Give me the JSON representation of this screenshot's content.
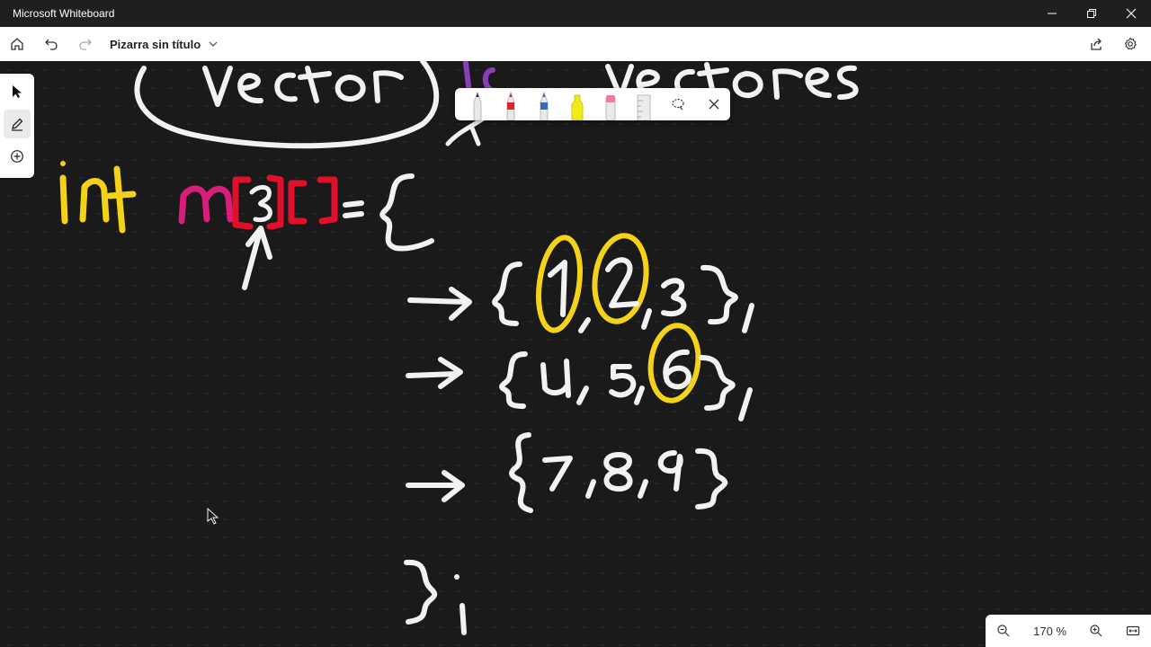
{
  "window": {
    "title": "Microsoft Whiteboard"
  },
  "toolbar": {
    "doc_title": "Pizarra sin título"
  },
  "zoom": {
    "level": "170 %"
  },
  "icons": {
    "home": "home-icon",
    "undo": "undo-icon",
    "redo": "redo-icon",
    "chevron": "chevron-down-icon",
    "share": "share-icon",
    "settings": "gear-icon",
    "select": "pointer-icon",
    "pen": "pen-icon",
    "add": "plus-circle-icon",
    "lasso": "lasso-icon",
    "close": "close-icon",
    "zoom_out": "zoom-out-icon",
    "zoom_in": "zoom-in-icon",
    "fit": "fit-screen-icon"
  },
  "pens": [
    {
      "name": "black-pen",
      "color": "#2b2b2b"
    },
    {
      "name": "red-pen",
      "color": "#d8262e"
    },
    {
      "name": "blue-pen",
      "color": "#2f6fb7"
    },
    {
      "name": "yellow-highlighter",
      "color": "#f1ea1a"
    },
    {
      "name": "pink-eraser",
      "color": "#f07a9a"
    }
  ],
  "colors": {
    "ink_white": "#f2f2f2",
    "ink_yellow": "#f4d21a",
    "ink_magenta": "#d81e7a",
    "ink_red": "#e0102a"
  }
}
